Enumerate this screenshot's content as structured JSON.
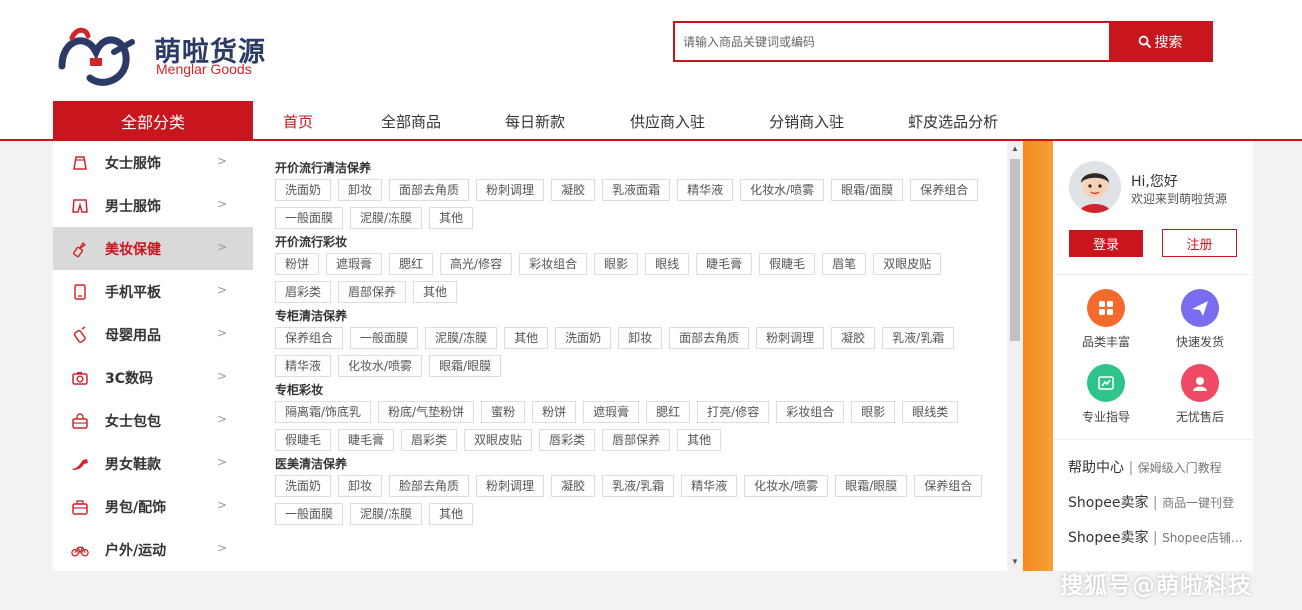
{
  "brand": {
    "name_cn": "萌啦货源",
    "name_en": "Menglar Goods",
    "primary": "#c9151e"
  },
  "search": {
    "placeholder": "请输入商品关键词或编码",
    "button_label": "搜索"
  },
  "nav": {
    "all_label": "全部分类",
    "items": [
      {
        "label": "首页",
        "active": true
      },
      {
        "label": "全部商品"
      },
      {
        "label": "每日新款"
      },
      {
        "label": "供应商入驻"
      },
      {
        "label": "分销商入驻"
      },
      {
        "label": "虾皮选品分析"
      }
    ]
  },
  "sidebar": {
    "items": [
      {
        "label": "女士服饰",
        "icon": "skirt-icon"
      },
      {
        "label": "男士服饰",
        "icon": "shorts-icon"
      },
      {
        "label": "美妆保健",
        "icon": "lipstick-icon",
        "active": true
      },
      {
        "label": "手机平板",
        "icon": "phone-icon"
      },
      {
        "label": "母婴用品",
        "icon": "bottle-icon"
      },
      {
        "label": "3C数码",
        "icon": "camera-icon"
      },
      {
        "label": "女士包包",
        "icon": "handbag-icon"
      },
      {
        "label": "男女鞋款",
        "icon": "heel-icon"
      },
      {
        "label": "男包/配饰",
        "icon": "briefcase-icon"
      },
      {
        "label": "户外/运动",
        "icon": "bicycle-icon"
      }
    ]
  },
  "panel": {
    "groups": [
      {
        "title": "开价流行清洁保养",
        "tags": [
          "洗面奶",
          "卸妆",
          "面部去角质",
          "粉刺调理",
          "凝胶",
          "乳液面霜",
          "精华液",
          "化妆水/喷雾",
          "眼霜/面膜",
          "保养组合",
          "一般面膜",
          "泥膜/冻膜",
          "其他"
        ]
      },
      {
        "title": "开价流行彩妆",
        "tags": [
          "粉饼",
          "遮瑕膏",
          "腮红",
          "高光/修容",
          "彩妆组合",
          "眼影",
          "眼线",
          "睫毛膏",
          "假睫毛",
          "眉笔",
          "双眼皮贴",
          "眉彩类",
          "眉部保养",
          "其他"
        ]
      },
      {
        "title": "专柜清洁保养",
        "tags": [
          "保养组合",
          "一般面膜",
          "泥膜/冻膜",
          "其他",
          "洗面奶",
          "卸妆",
          "面部去角质",
          "粉刺调理",
          "凝胶",
          "乳液/乳霜",
          "精华液",
          "化妆水/喷雾",
          "眼霜/眼膜"
        ]
      },
      {
        "title": "专柜彩妆",
        "tags": [
          "隔离霜/饰底乳",
          "粉底/气垫粉饼",
          "蜜粉",
          "粉饼",
          "遮瑕膏",
          "腮红",
          "打亮/修容",
          "彩妆组合",
          "眼影",
          "眼线类",
          "假睫毛",
          "睫毛膏",
          "眉彩类",
          "双眼皮贴",
          "唇彩类",
          "唇部保养",
          "其他"
        ]
      },
      {
        "title": "医美清洁保养",
        "tags": [
          "洗面奶",
          "卸妆",
          "脸部去角质",
          "粉刺调理",
          "凝胶",
          "乳液/乳霜",
          "精华液",
          "化妆水/喷雾",
          "眼霜/眼膜",
          "保养组合",
          "一般面膜",
          "泥膜/冻膜",
          "其他"
        ]
      }
    ]
  },
  "user": {
    "greeting": "Hi,您好",
    "welcome": "欢迎来到萌啦货源",
    "login_label": "登录",
    "register_label": "注册"
  },
  "features": [
    {
      "label": "品类丰富",
      "color": "#f46a2c",
      "icon": "grid-icon"
    },
    {
      "label": "快速发货",
      "color": "#7a6cf0",
      "icon": "plane-icon"
    },
    {
      "label": "专业指导",
      "color": "#2fc48a",
      "icon": "chart-icon"
    },
    {
      "label": "无忧售后",
      "color": "#ef4a65",
      "icon": "service-icon"
    }
  ],
  "help": [
    {
      "main": "帮助中心",
      "sub": "保姆级入门教程"
    },
    {
      "main": "Shopee卖家",
      "sub": "商品一键刊登"
    },
    {
      "main": "Shopee卖家",
      "sub": "Shopee店铺..."
    }
  ],
  "watermark": "搜狐号@萌啦科技"
}
